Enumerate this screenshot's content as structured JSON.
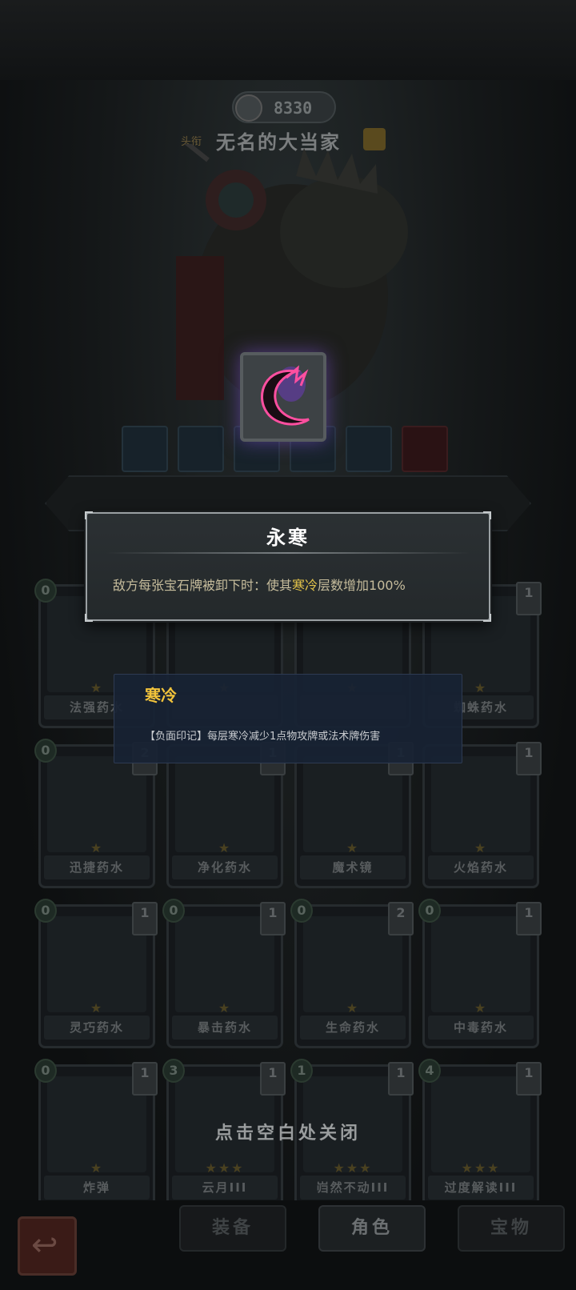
{
  "header": {
    "gold": "8330",
    "name_tag": "头衔",
    "character_name": "无名的大当家"
  },
  "relic_popup": {
    "title": "永寒",
    "desc_prefix": "敌方每张宝石牌被卸下时：使其",
    "desc_keyword": "寒冷",
    "desc_suffix": "层数增加100%"
  },
  "keyword_popup": {
    "title": "寒冷",
    "desc": "【负面印记】每层寒冷减少1点物攻牌或法术牌伤害"
  },
  "cards": [
    {
      "label": "法强药水",
      "cost": "0",
      "stack": "",
      "stars": "★"
    },
    {
      "label": "",
      "cost": "",
      "stack": "",
      "stars": "★"
    },
    {
      "label": "",
      "cost": "",
      "stack": "",
      "stars": "★"
    },
    {
      "label": "蜘蛛药水",
      "cost": "",
      "stack": "1",
      "stars": "★"
    },
    {
      "label": "迅捷药水",
      "cost": "0",
      "stack": "2",
      "stars": "★"
    },
    {
      "label": "净化药水",
      "cost": "",
      "stack": "1",
      "stars": "★"
    },
    {
      "label": "魔术镜",
      "cost": "",
      "stack": "1",
      "stars": "★"
    },
    {
      "label": "火焰药水",
      "cost": "",
      "stack": "1",
      "stars": "★"
    },
    {
      "label": "灵巧药水",
      "cost": "0",
      "stack": "1",
      "stars": "★"
    },
    {
      "label": "暴击药水",
      "cost": "0",
      "stack": "1",
      "stars": "★"
    },
    {
      "label": "生命药水",
      "cost": "0",
      "stack": "2",
      "stars": "★"
    },
    {
      "label": "中毒药水",
      "cost": "0",
      "stack": "1",
      "stars": "★"
    },
    {
      "label": "炸弹",
      "cost": "0",
      "stack": "1",
      "stars": "★"
    },
    {
      "label": "云月III",
      "cost": "3",
      "stack": "1",
      "stars": "★★★"
    },
    {
      "label": "岿然不动III",
      "cost": "1",
      "stack": "1",
      "stars": "★★★"
    },
    {
      "label": "过度解读III",
      "cost": "4",
      "stack": "1",
      "stars": "★★★"
    }
  ],
  "close_hint": "点击空白处关闭",
  "nav": {
    "back_icon": "↩",
    "tab_equip": "装备",
    "tab_character": "角色",
    "tab_relic": "宝物"
  },
  "colors": {
    "popup_title": "#ffffff",
    "keyword_highlight": "#e4c44a",
    "keyword_popup_title": "#f2c33b",
    "relic_glow": "#ff4fa0"
  }
}
